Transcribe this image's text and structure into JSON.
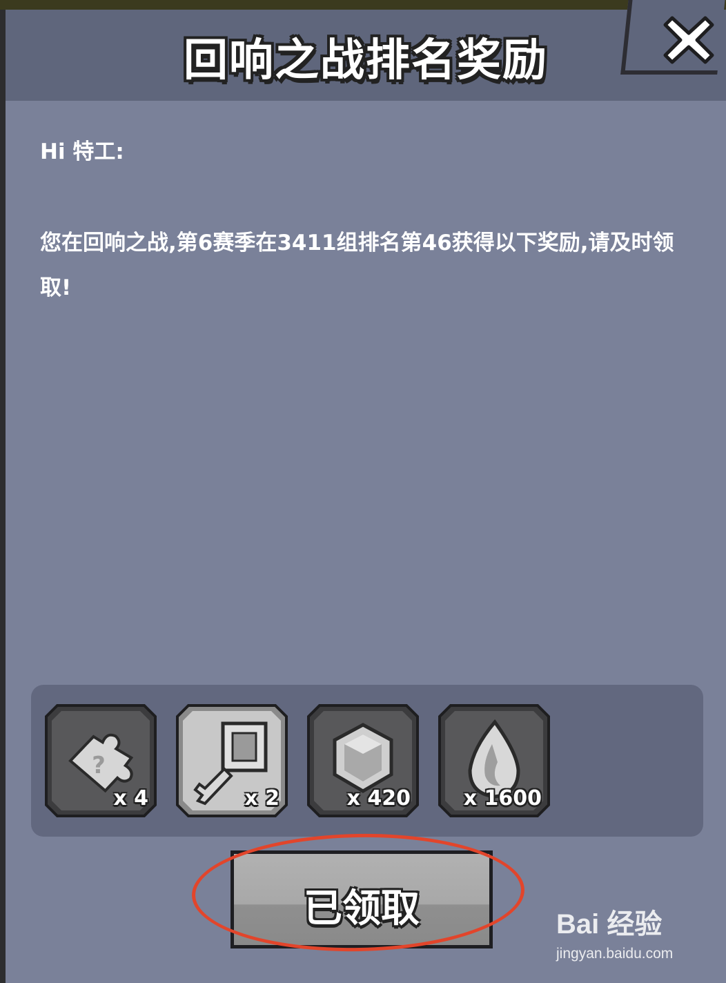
{
  "window": {
    "title": "回响之战排名奖励",
    "close_icon": "close-x-icon"
  },
  "mail": {
    "greeting": "Hi 特工:",
    "message": "您在回响之战,第6赛季在3411组排名第46获得以下奖励,请及时领取!"
  },
  "rewards": [
    {
      "icon": "puzzle-piece-icon",
      "quantity": "x 4"
    },
    {
      "icon": "key-icon",
      "quantity": "x 2"
    },
    {
      "icon": "gem-icon",
      "quantity": "x 420"
    },
    {
      "icon": "flame-drop-icon",
      "quantity": "x 1600"
    }
  ],
  "claim_button": {
    "label": "已领取"
  },
  "watermark": {
    "logo": "Bai 经验",
    "url": "jingyan.baidu.com"
  },
  "colors": {
    "panel": "#7a8199",
    "header": "#5f667c",
    "rewards_bg": "#62687f",
    "highlight": "#e2452b"
  }
}
